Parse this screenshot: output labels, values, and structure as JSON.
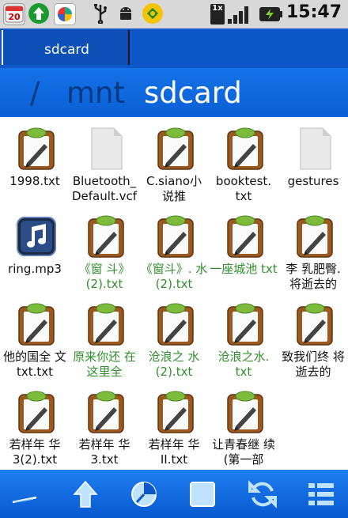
{
  "status_bar": {
    "icons": [
      "calendar-20-icon",
      "upload-arrow-icon",
      "google-app-icon",
      "usb-icon",
      "android-debug-icon",
      "download-app-icon"
    ],
    "calendar_day": "20",
    "network_label": "1x",
    "time": "15:47"
  },
  "tab": {
    "label": "sdcard"
  },
  "path": {
    "separator": "/",
    "parent": "mnt",
    "current": "sdcard"
  },
  "files": [
    {
      "name": "1998.txt",
      "type": "text",
      "green": false
    },
    {
      "name": "Bluetooth_ Default.vcf",
      "type": "doc",
      "green": false
    },
    {
      "name": "C.siano小 说推",
      "type": "text",
      "green": false
    },
    {
      "name": "booktest. txt",
      "type": "text",
      "green": false
    },
    {
      "name": "gestures",
      "type": "doc",
      "green": false
    },
    {
      "name": "ring.mp3",
      "type": "music",
      "green": false
    },
    {
      "name": "《窗 斗》(2).txt",
      "type": "text",
      "green": true
    },
    {
      "name": "《窗斗》. 水(2).txt",
      "type": "text",
      "green": true
    },
    {
      "name": "一座城池 txt",
      "type": "text",
      "green": true
    },
    {
      "name": "李 乳肥臀. 将逝去的",
      "type": "text",
      "green": false
    },
    {
      "name": "他的国全 文txt.txt",
      "type": "text",
      "green": false
    },
    {
      "name": "原来你还 在这里全",
      "type": "text",
      "green": true
    },
    {
      "name": "沧浪之 水(2).txt",
      "type": "text",
      "green": true
    },
    {
      "name": "沧浪之水. txt",
      "type": "text",
      "green": true
    },
    {
      "name": "致我们终 将逝去的",
      "type": "text",
      "green": false
    },
    {
      "name": "若样年 华3(2).txt",
      "type": "text",
      "green": false
    },
    {
      "name": "若样年 华3.txt",
      "type": "text",
      "green": false
    },
    {
      "name": "若样年 华II.txt",
      "type": "text",
      "green": false
    },
    {
      "name": "让青春继 续(第一部",
      "type": "text",
      "green": false
    }
  ],
  "toolbar": [
    "edit-icon",
    "up-folder-icon",
    "clock-icon",
    "select-icon",
    "refresh-icon",
    "menu-list-icon"
  ],
  "colors": {
    "accent": "#0d57c9",
    "green_label": "#2f8e2a"
  }
}
